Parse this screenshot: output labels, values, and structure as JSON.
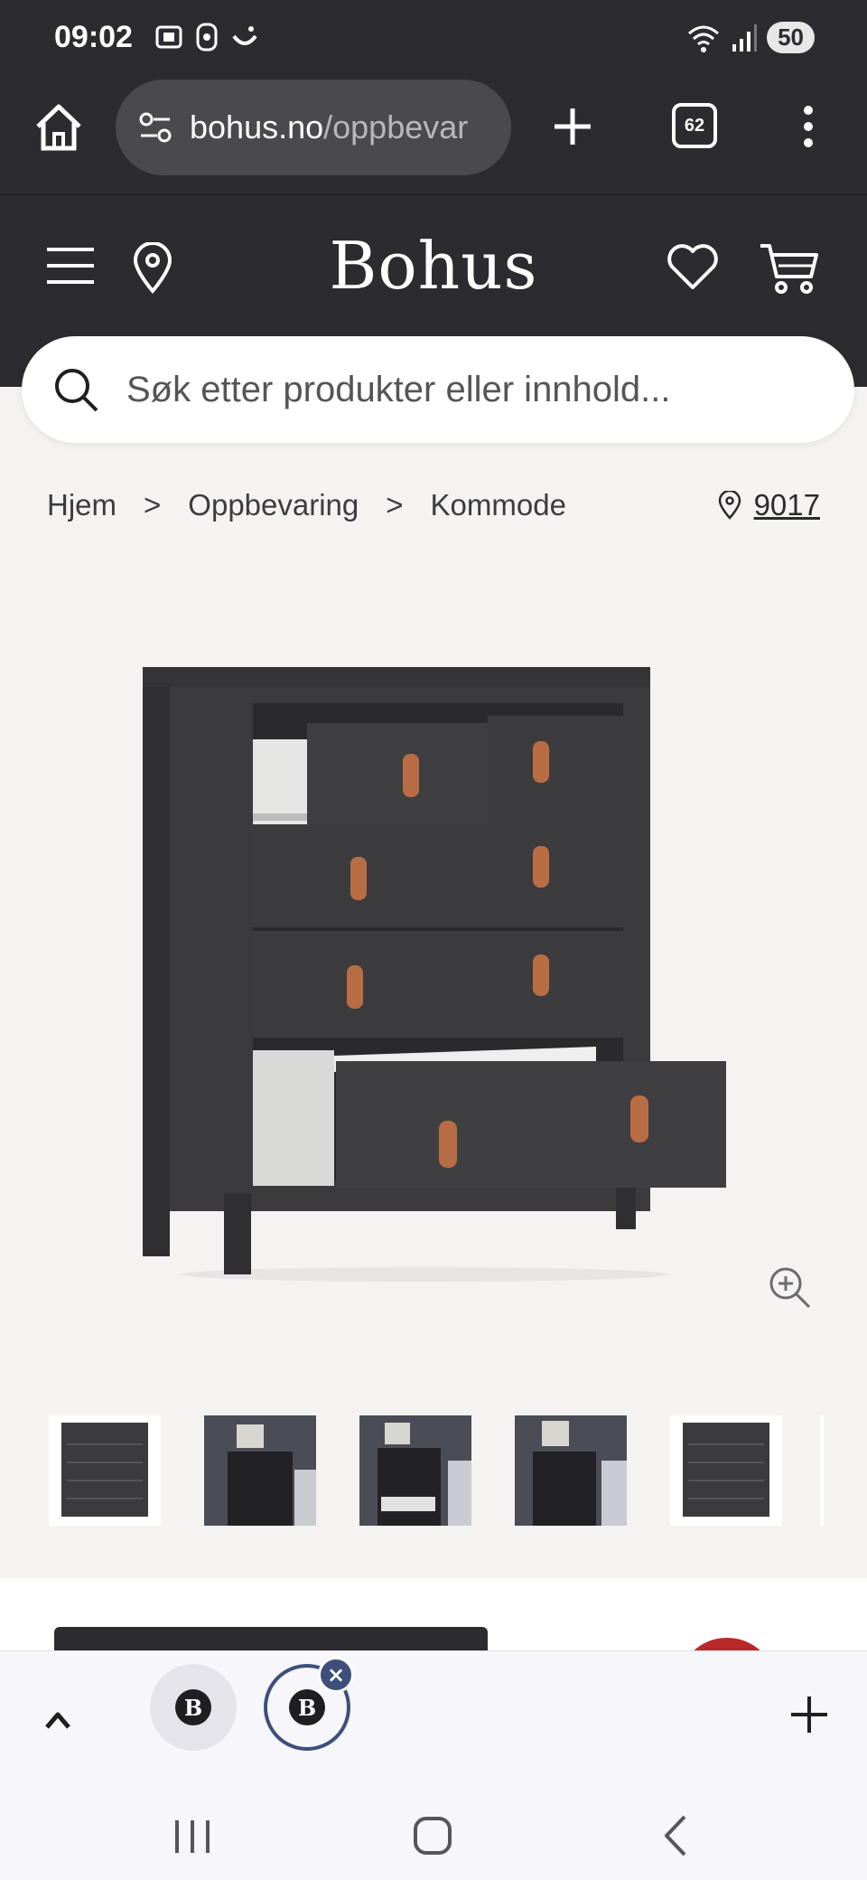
{
  "status_bar": {
    "time": "09:02",
    "battery": "50"
  },
  "browser": {
    "url_domain": "bohus.no",
    "url_path": "/oppbevar",
    "tab_count": "62"
  },
  "site": {
    "logo": "Bohus"
  },
  "search": {
    "placeholder": "Søk etter produkter eller innhold..."
  },
  "breadcrumb": {
    "items": [
      "Hjem",
      "Oppbevaring",
      "Kommode"
    ],
    "separator": ">"
  },
  "location": {
    "postcode": "9017"
  },
  "product": {
    "image_alt": "Kommode",
    "thumbnails": 5
  },
  "bottom_tabs": {
    "tab_logo": "B",
    "close_glyph": "×"
  },
  "colors": {
    "header_bg": "#2c2c30",
    "page_bg": "#f4f3f1",
    "accent": "#3d4f7a",
    "leather": "#b96d45",
    "dresser": "#3b3b3e"
  }
}
